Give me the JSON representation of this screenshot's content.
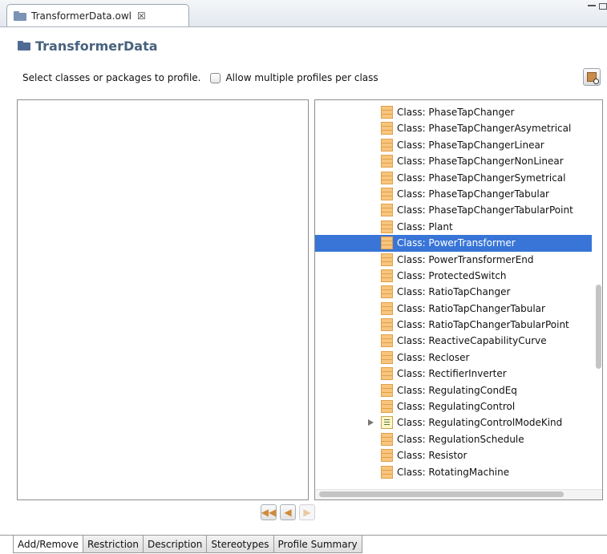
{
  "editor": {
    "tab_title": "TransformerData.owl",
    "tab_close": "☒"
  },
  "header": {
    "title": "TransformerData"
  },
  "toolbar": {
    "select_text": "Select classes or packages to profile.",
    "allow_multiple_label": "Allow multiple profiles per class",
    "allow_multiple_checked": false
  },
  "tree": {
    "items": [
      {
        "label": "Class: PhaseTapChanger",
        "icon": "class-icon"
      },
      {
        "label": "Class: PhaseTapChangerAsymetrical",
        "icon": "class-icon"
      },
      {
        "label": "Class: PhaseTapChangerLinear",
        "icon": "class-icon"
      },
      {
        "label": "Class: PhaseTapChangerNonLinear",
        "icon": "class-icon"
      },
      {
        "label": "Class: PhaseTapChangerSymetrical",
        "icon": "class-icon"
      },
      {
        "label": "Class: PhaseTapChangerTabular",
        "icon": "class-icon"
      },
      {
        "label": "Class: PhaseTapChangerTabularPoint",
        "icon": "class-icon"
      },
      {
        "label": "Class: Plant",
        "icon": "class-icon"
      },
      {
        "label": "Class: PowerTransformer",
        "icon": "class-icon",
        "selected": true
      },
      {
        "label": "Class: PowerTransformerEnd",
        "icon": "class-icon"
      },
      {
        "label": "Class: ProtectedSwitch",
        "icon": "class-icon"
      },
      {
        "label": "Class: RatioTapChanger",
        "icon": "class-icon"
      },
      {
        "label": "Class: RatioTapChangerTabular",
        "icon": "class-icon"
      },
      {
        "label": "Class: RatioTapChangerTabularPoint",
        "icon": "class-icon"
      },
      {
        "label": "Class: ReactiveCapabilityCurve",
        "icon": "class-icon"
      },
      {
        "label": "Class: Recloser",
        "icon": "class-icon"
      },
      {
        "label": "Class: RectifierInverter",
        "icon": "class-icon"
      },
      {
        "label": "Class: RegulatingCondEq",
        "icon": "class-icon"
      },
      {
        "label": "Class: RegulatingControl",
        "icon": "class-icon"
      },
      {
        "label": "Class: RegulatingControlModeKind",
        "icon": "enum-icon",
        "expandable": true
      },
      {
        "label": "Class: RegulationSchedule",
        "icon": "class-icon"
      },
      {
        "label": "Class: Resistor",
        "icon": "class-icon"
      },
      {
        "label": "Class: RotatingMachine",
        "icon": "class-icon"
      }
    ]
  },
  "nav": {
    "add_all": "◀◀",
    "add": "◀",
    "remove": "▶"
  },
  "bottom_tabs": [
    {
      "label": "Add/Remove",
      "active": true
    },
    {
      "label": "Restriction"
    },
    {
      "label": "Description"
    },
    {
      "label": "Stereotypes"
    },
    {
      "label": "Profile Summary"
    }
  ],
  "colors": {
    "selection": "#3875d7",
    "header_title": "#48627e",
    "class_icon": "#f7c57e"
  }
}
